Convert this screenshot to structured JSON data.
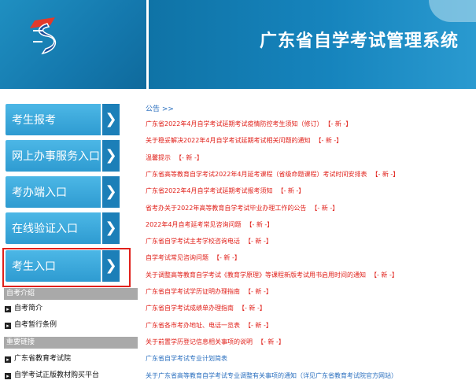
{
  "header": {
    "title": "广东省自学考试管理系统"
  },
  "sidebar": {
    "buttons": [
      {
        "label": "考生报考"
      },
      {
        "label": "网上办事服务入口"
      },
      {
        "label": "考办端入口"
      },
      {
        "label": "在线验证入口"
      },
      {
        "label": "考生入口"
      }
    ],
    "arrow_glyph": "❯",
    "highlight_color": "#e0201a",
    "sections": [
      {
        "title": "自考介绍",
        "items": [
          "自考简介",
          "自考暂行条例"
        ]
      },
      {
        "title": "重要链接",
        "items": [
          "广东省教育考试院",
          "自学考试正版教材购买平台"
        ]
      }
    ]
  },
  "main": {
    "notice_head": "公告 >>",
    "new_tag": "【- 新 -】",
    "notices": [
      {
        "text": "广东省2022年4月自学考试延期考试疫情防控考生须知（修订）",
        "new": true,
        "color": "red"
      },
      {
        "text": "关于稳妥解决2022年4月自学考试延期考试相关问题的通知",
        "new": true,
        "color": "red"
      },
      {
        "text": "温馨提示",
        "new": true,
        "color": "red"
      },
      {
        "text": "广东省高等教育自学考试2022年4月延考课程（省级命题课程）考试时间安排表",
        "new": true,
        "color": "red"
      },
      {
        "text": "广东省2022年4月自学考试延期考试报考须知",
        "new": true,
        "color": "red"
      },
      {
        "text": "省考办关于2022年高等教育自学考试毕业办理工作的公告",
        "new": true,
        "color": "red"
      },
      {
        "text": "2022年4月自考延考常见咨询问题",
        "new": true,
        "color": "red"
      },
      {
        "text": "广东省自学考试主考学校咨询电话",
        "new": true,
        "color": "red"
      },
      {
        "text": "自学考试常见咨询问题",
        "new": true,
        "color": "red"
      },
      {
        "text": "关于调整高等教育自学考试《教育学原理》等课程新版考试用书启用时间的通知",
        "new": true,
        "color": "red"
      },
      {
        "text": "广东省自学考试学历证明办理指南",
        "new": true,
        "color": "red"
      },
      {
        "text": "广东省自学考试成绩单办理指南",
        "new": true,
        "color": "red"
      },
      {
        "text": "广东省各市考办地址、电话一览表",
        "new": true,
        "color": "red"
      },
      {
        "text": "关于前置学历登记信息相关事项的说明",
        "new": true,
        "color": "red"
      },
      {
        "text": "广东省自学考试专业计划简表",
        "new": false,
        "color": "blue"
      },
      {
        "text": "关于广东省高等教育自学考试专业调整有关事项的通知（详见广东省教育考试院官方网站）",
        "new": false,
        "color": "blue"
      }
    ]
  }
}
